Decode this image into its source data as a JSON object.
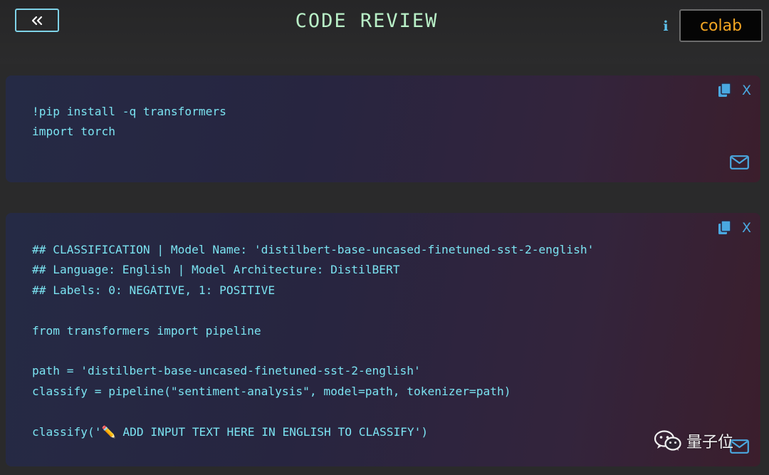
{
  "header": {
    "back_icon": "double-chevron-left-icon",
    "title": "CODE REVIEW",
    "info_label": "i",
    "colab_label": "colab"
  },
  "colors": {
    "accent": "#7fd3e8",
    "title": "#b9f0c7",
    "code_text": "#7be3f1",
    "icon_blue": "#4aa8e0",
    "colab_orange": "#f4a623",
    "background": "#2a2a2b"
  },
  "cells": [
    {
      "code": "!pip install -q transformers\nimport torch",
      "copy_icon": "copy-icon",
      "close_label": "X",
      "mail_icon": "mail-icon"
    },
    {
      "code": "## CLASSIFICATION | Model Name: 'distilbert-base-uncased-finetuned-sst-2-english'\n## Language: English | Model Architecture: DistilBERT\n## Labels: 0: NEGATIVE, 1: POSITIVE\n\nfrom transformers import pipeline\n\npath = 'distilbert-base-uncased-finetuned-sst-2-english'\nclassify = pipeline(\"sentiment-analysis\", model=path, tokenizer=path)\n\nclassify('✏️ ADD INPUT TEXT HERE IN ENGLISH TO CLASSIFY')",
      "copy_icon": "copy-icon",
      "close_label": "X",
      "mail_icon": "mail-icon"
    }
  ],
  "watermark": {
    "icon": "wechat-icon",
    "text": "量子位"
  }
}
